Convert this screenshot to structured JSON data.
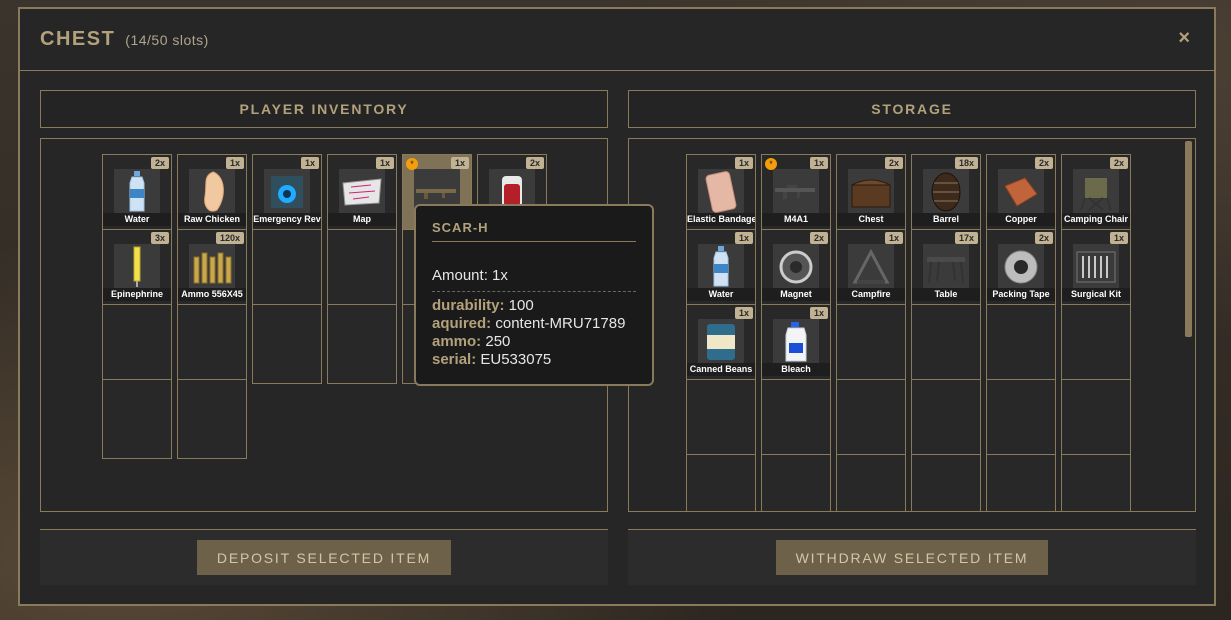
{
  "header": {
    "title": "CHEST",
    "slots": "(14/50 slots)",
    "close": "×"
  },
  "player": {
    "heading": "PLAYER INVENTORY",
    "button": "DEPOSIT SELECTED ITEM",
    "items": [
      {
        "label": "Water",
        "qty": "2x",
        "icon": "water-bottle-icon"
      },
      {
        "label": "Raw Chicken",
        "qty": "1x",
        "icon": "raw-chicken-icon"
      },
      {
        "label": "Emergency Rev",
        "qty": "1x",
        "icon": "emergency-revive-icon"
      },
      {
        "label": "Map",
        "qty": "1x",
        "icon": "map-icon"
      },
      {
        "label": "",
        "qty": "1x",
        "icon": "scar-h-rifle-icon",
        "star": "*"
      },
      {
        "label": "",
        "qty": "2x",
        "icon": "blood-bag-icon"
      },
      {
        "label": "Epinephrine",
        "qty": "3x",
        "icon": "epinephrine-icon"
      },
      {
        "label": "Ammo 556X45",
        "qty": "120x",
        "icon": "ammo-icon"
      }
    ]
  },
  "storage": {
    "heading": "STORAGE",
    "button": "WITHDRAW SELECTED ITEM",
    "items": [
      {
        "label": "Elastic Bandage",
        "qty": "1x",
        "icon": "bandage-icon"
      },
      {
        "label": "M4A1",
        "qty": "1x",
        "icon": "m4a1-rifle-icon",
        "star": "*"
      },
      {
        "label": "Chest",
        "qty": "2x",
        "icon": "chest-icon"
      },
      {
        "label": "Barrel",
        "qty": "18x",
        "icon": "barrel-icon"
      },
      {
        "label": "Copper",
        "qty": "2x",
        "icon": "copper-icon"
      },
      {
        "label": "Camping Chair",
        "qty": "2x",
        "icon": "camping-chair-icon"
      },
      {
        "label": "Water",
        "qty": "1x",
        "icon": "water-bottle-icon"
      },
      {
        "label": "Magnet",
        "qty": "2x",
        "icon": "magnet-icon"
      },
      {
        "label": "Campfire",
        "qty": "1x",
        "icon": "campfire-icon"
      },
      {
        "label": "Table",
        "qty": "17x",
        "icon": "table-icon"
      },
      {
        "label": "Packing Tape",
        "qty": "2x",
        "icon": "tape-icon"
      },
      {
        "label": "Surgical Kit",
        "qty": "1x",
        "icon": "surgical-kit-icon"
      },
      {
        "label": "Canned Beans",
        "qty": "1x",
        "icon": "canned-beans-icon"
      },
      {
        "label": "Bleach",
        "qty": "1x",
        "icon": "bleach-icon"
      }
    ]
  },
  "tooltip": {
    "title": "SCAR-H",
    "amount": "Amount: 1x",
    "rows": [
      {
        "key": "durability:",
        "value": " 100"
      },
      {
        "key": "aquired:",
        "value": " content-MRU71789"
      },
      {
        "key": "ammo:",
        "value": " 250"
      },
      {
        "key": "serial:",
        "value": " EU533075"
      }
    ]
  },
  "colors": {
    "accent": "#8a7a5c",
    "gold_text": "#b3a17c",
    "button": "#6e6149",
    "star": "#f59e0b"
  }
}
